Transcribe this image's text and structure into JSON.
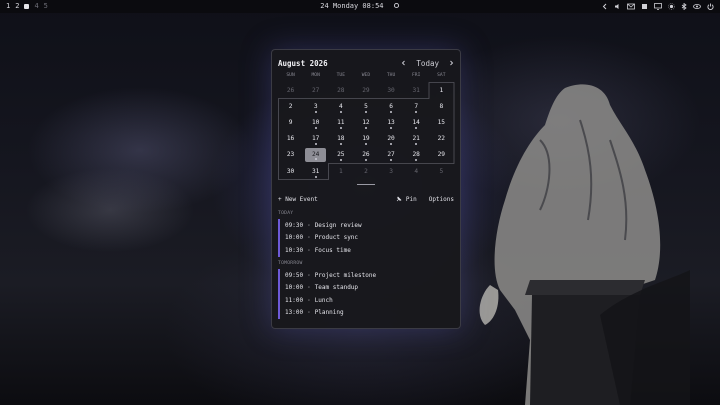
{
  "topbar": {
    "workspaces": [
      "1",
      "2",
      "4",
      "5"
    ],
    "clock": "24 Monday 08:54",
    "tray_icons": [
      "chevron-left-icon",
      "volume-icon",
      "mail-icon",
      "network-icon",
      "monitor-icon",
      "brightness-icon",
      "bluetooth-icon",
      "eye-icon",
      "power-icon"
    ]
  },
  "calendar": {
    "month_title": "August 2026",
    "today_label": "Today",
    "weekdays": [
      "SUN",
      "MON",
      "TUE",
      "WED",
      "THU",
      "FRI",
      "SAT"
    ],
    "days": [
      {
        "d": "26",
        "out": true
      },
      {
        "d": "27",
        "out": true
      },
      {
        "d": "28",
        "out": true
      },
      {
        "d": "29",
        "out": true
      },
      {
        "d": "30",
        "out": true
      },
      {
        "d": "31",
        "out": true
      },
      {
        "d": "1"
      },
      {
        "d": "2"
      },
      {
        "d": "3",
        "dot": true
      },
      {
        "d": "4",
        "dot": true
      },
      {
        "d": "5",
        "dot": true
      },
      {
        "d": "6",
        "dot": true
      },
      {
        "d": "7",
        "dot": true
      },
      {
        "d": "8"
      },
      {
        "d": "9"
      },
      {
        "d": "10",
        "dot": true
      },
      {
        "d": "11",
        "dot": true
      },
      {
        "d": "12",
        "dot": true
      },
      {
        "d": "13",
        "dot": true
      },
      {
        "d": "14",
        "dot": true
      },
      {
        "d": "15"
      },
      {
        "d": "16"
      },
      {
        "d": "17",
        "dot": true
      },
      {
        "d": "18",
        "dot": true
      },
      {
        "d": "19",
        "dot": true
      },
      {
        "d": "20",
        "dot": true
      },
      {
        "d": "21",
        "dot": true
      },
      {
        "d": "22"
      },
      {
        "d": "23"
      },
      {
        "d": "24",
        "today": true,
        "dot": true
      },
      {
        "d": "25",
        "dot": true
      },
      {
        "d": "26",
        "dot": true
      },
      {
        "d": "27",
        "dot": true
      },
      {
        "d": "28",
        "dot": true
      },
      {
        "d": "29"
      },
      {
        "d": "30"
      },
      {
        "d": "31",
        "dot": true
      },
      {
        "d": "1",
        "out": true
      },
      {
        "d": "2",
        "out": true
      },
      {
        "d": "3",
        "out": true
      },
      {
        "d": "4",
        "out": true
      },
      {
        "d": "5",
        "out": true
      }
    ],
    "new_event_label": "+ New Event",
    "pin_label": "Pin",
    "options_label": "Options"
  },
  "agenda": {
    "today_heading": "TODAY",
    "today_events": [
      {
        "time": "09:30",
        "title": "Design review"
      },
      {
        "time": "10:00",
        "title": "Product sync"
      },
      {
        "time": "10:30",
        "title": "Focus time"
      }
    ],
    "tomorrow_heading": "TOMORROW",
    "tomorrow_events": [
      {
        "time": "09:50",
        "title": "Project milestone"
      },
      {
        "time": "10:00",
        "title": "Team standup"
      },
      {
        "time": "11:00",
        "title": "Lunch"
      },
      {
        "time": "13:00",
        "title": "Planning"
      }
    ],
    "separator": "·"
  },
  "colors": {
    "accent": "#6d5ad6",
    "today_fill": "#8e8e96",
    "panel_bg": "#18181c"
  }
}
